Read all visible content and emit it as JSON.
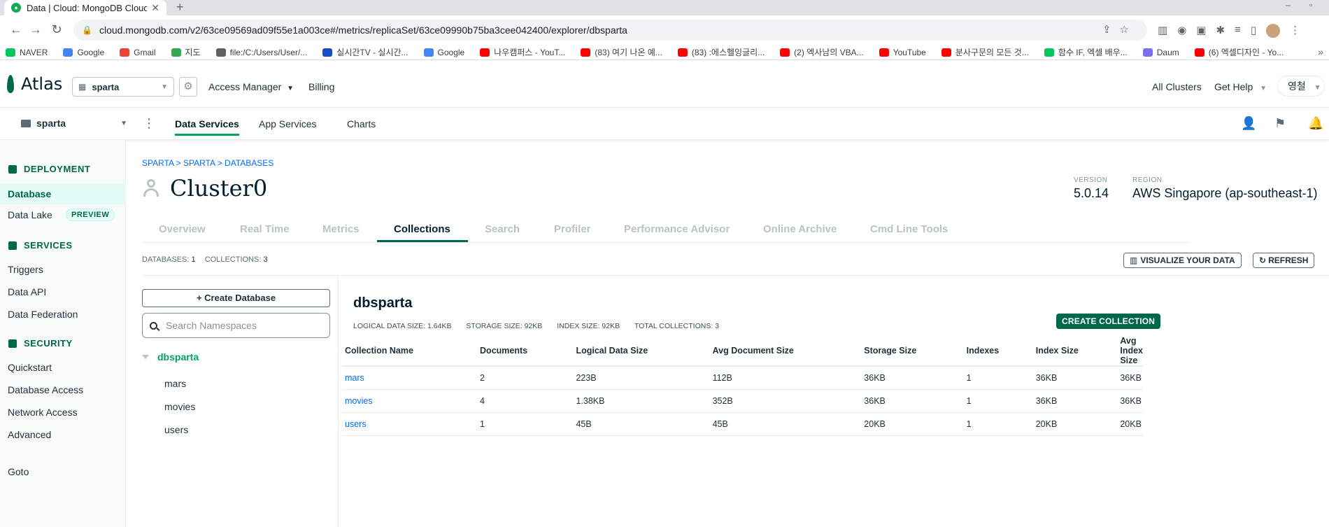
{
  "browser": {
    "tab_title": "Data | Cloud: MongoDB Cloud",
    "url": "cloud.mongodb.com/v2/63ce09569ad09f55e1a003ce#/metrics/replicaSet/63ce09990b75ba3cee042400/explorer/dbsparta",
    "bookmarks": [
      {
        "label": "NAVER",
        "color": "#03c75a"
      },
      {
        "label": "Google",
        "color": "#4285f4"
      },
      {
        "label": "Gmail",
        "color": "#ea4335"
      },
      {
        "label": "지도",
        "color": "#34a853"
      },
      {
        "label": "file:/C:/Users/User/...",
        "color": "#5f6368"
      },
      {
        "label": "실시간TV - 실시간...",
        "color": "#1a4fc4"
      },
      {
        "label": "Google",
        "color": "#4285f4"
      },
      {
        "label": "나우캠퍼스 - YouT...",
        "color": "#ff0000"
      },
      {
        "label": "(83) 여기 나온 예...",
        "color": "#ff0000"
      },
      {
        "label": "(83) :에스헬잉글리...",
        "color": "#ff0000"
      },
      {
        "label": "(2) 엑사남의 VBA...",
        "color": "#ff0000"
      },
      {
        "label": "YouTube",
        "color": "#ff0000"
      },
      {
        "label": "분사구문의 모든 것...",
        "color": "#ff0000"
      },
      {
        "label": "함수 IF, 엑셀 배우...",
        "color": "#03c75a"
      },
      {
        "label": "Daum",
        "color": "#7d6df0"
      },
      {
        "label": "(6) 엑셀디자인 - Yo...",
        "color": "#ff0000"
      }
    ]
  },
  "header": {
    "logo": "Atlas",
    "org": "sparta",
    "access_manager": "Access Manager",
    "billing": "Billing",
    "all_clusters": "All Clusters",
    "get_help": "Get Help",
    "user": "영철"
  },
  "subheader": {
    "project": "sparta",
    "tabs": [
      "Data Services",
      "App Services",
      "Charts"
    ]
  },
  "sidebar": {
    "deployment": "DEPLOYMENT",
    "database": "Database",
    "data_lake": "Data Lake",
    "preview": "PREVIEW",
    "services": "SERVICES",
    "triggers": "Triggers",
    "data_api": "Data API",
    "data_federation": "Data Federation",
    "security": "SECURITY",
    "quickstart": "Quickstart",
    "database_access": "Database Access",
    "network_access": "Network Access",
    "advanced": "Advanced",
    "goto": "Goto"
  },
  "cluster": {
    "breadcrumb": "SPARTA > SPARTA > DATABASES",
    "name": "Cluster0",
    "version_label": "VERSION",
    "version": "5.0.14",
    "region_label": "REGION",
    "region": "AWS Singapore (ap-southeast-1)",
    "tabs": [
      "Overview",
      "Real Time",
      "Metrics",
      "Collections",
      "Search",
      "Profiler",
      "Performance Advisor",
      "Online Archive",
      "Cmd Line Tools"
    ]
  },
  "summary": {
    "databases_label": "DATABASES:",
    "databases": "1",
    "collections_label": "COLLECTIONS:",
    "collections": "3",
    "visualize": "VISUALIZE YOUR DATA",
    "refresh": "REFRESH"
  },
  "namespaces": {
    "create_db": "Create Database",
    "search_placeholder": "Search Namespaces",
    "db": "dbsparta",
    "collections": [
      "mars",
      "movies",
      "users"
    ]
  },
  "detail": {
    "db_name": "dbsparta",
    "logical_size": "LOGICAL DATA SIZE: 1.64KB",
    "storage_size": "STORAGE SIZE: 92KB",
    "index_size": "INDEX SIZE: 92KB",
    "total_collections": "TOTAL COLLECTIONS: 3",
    "create_collection": "CREATE COLLECTION",
    "columns": [
      "Collection Name",
      "Documents",
      "Logical Data Size",
      "Avg Document Size",
      "Storage Size",
      "Indexes",
      "Index Size",
      "Avg Index Size"
    ],
    "rows": [
      [
        "mars",
        "2",
        "223B",
        "112B",
        "36KB",
        "1",
        "36KB",
        "36KB"
      ],
      [
        "movies",
        "4",
        "1.38KB",
        "352B",
        "36KB",
        "1",
        "36KB",
        "36KB"
      ],
      [
        "users",
        "1",
        "45B",
        "45B",
        "20KB",
        "1",
        "20KB",
        "20KB"
      ]
    ]
  }
}
